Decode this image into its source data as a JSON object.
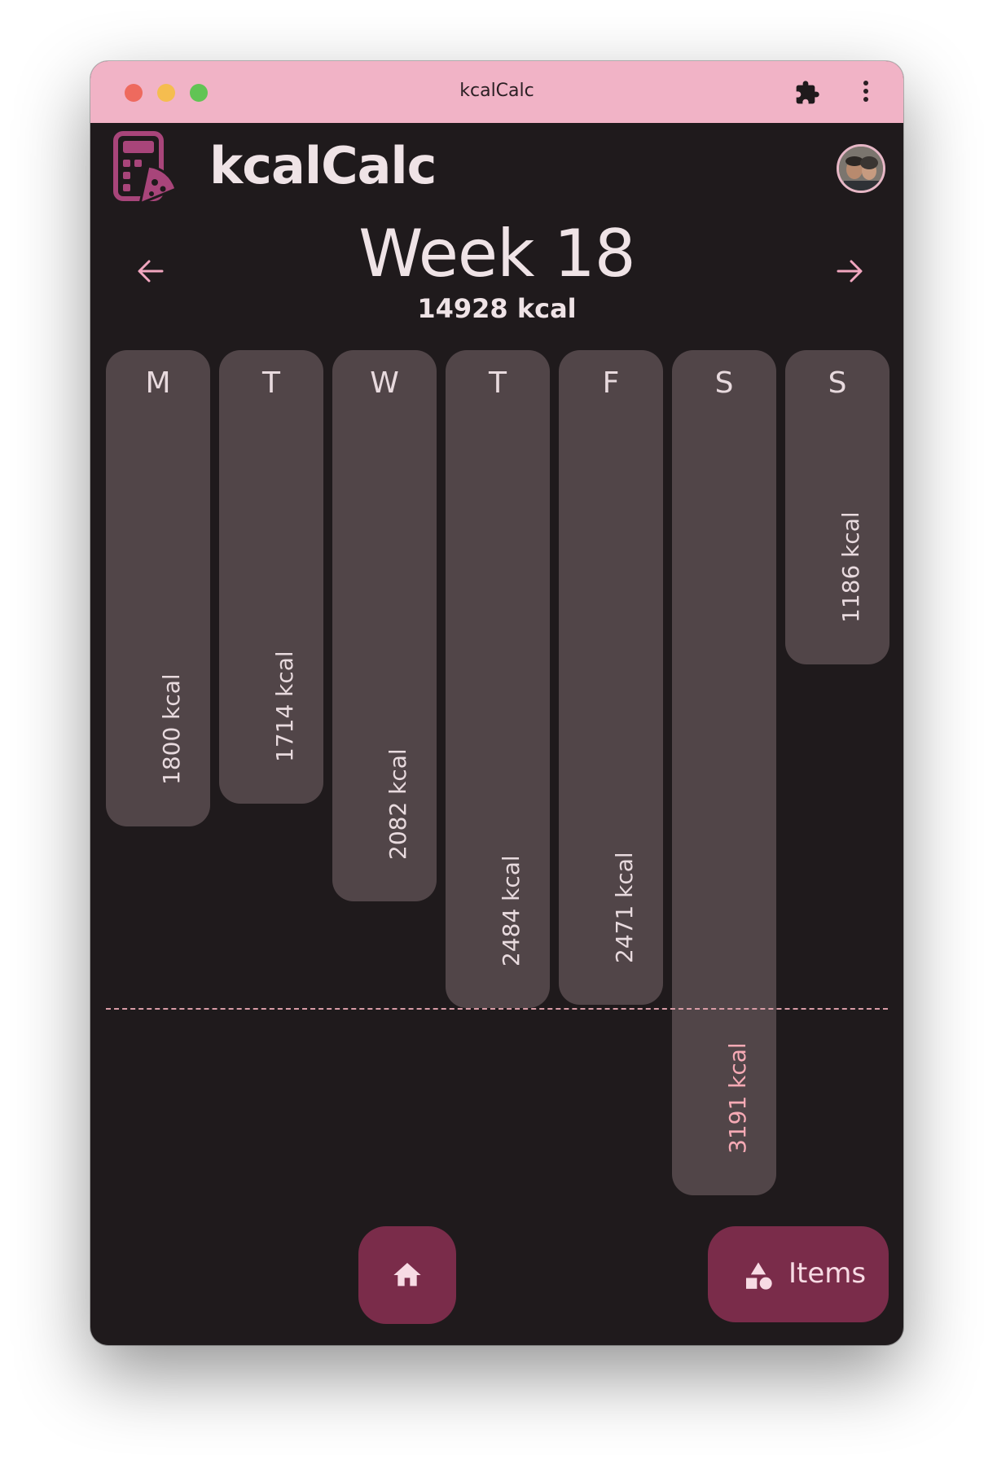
{
  "window": {
    "title": "kcalCalc"
  },
  "app": {
    "name": "kcalCalc"
  },
  "week": {
    "title": "Week 18",
    "total": "14928 kcal"
  },
  "days": [
    {
      "letter": "M",
      "kcal_label": "1800 kcal",
      "kcal": 1800
    },
    {
      "letter": "T",
      "kcal_label": "1714 kcal",
      "kcal": 1714
    },
    {
      "letter": "W",
      "kcal_label": "2082 kcal",
      "kcal": 2082
    },
    {
      "letter": "T",
      "kcal_label": "2484 kcal",
      "kcal": 2484
    },
    {
      "letter": "F",
      "kcal_label": "2471 kcal",
      "kcal": 2471
    },
    {
      "letter": "S",
      "kcal_label": "3191 kcal",
      "kcal": 3191
    },
    {
      "letter": "S",
      "kcal_label": "1186 kcal",
      "kcal": 1186
    }
  ],
  "nav": {
    "items_label": "Items"
  },
  "colors": {
    "background": "#1f1a1c",
    "titlebar": "#f1b3c6",
    "accent": "#7a2c4a",
    "bar": "#514548",
    "over_limit_text": "#f6aab5"
  }
}
